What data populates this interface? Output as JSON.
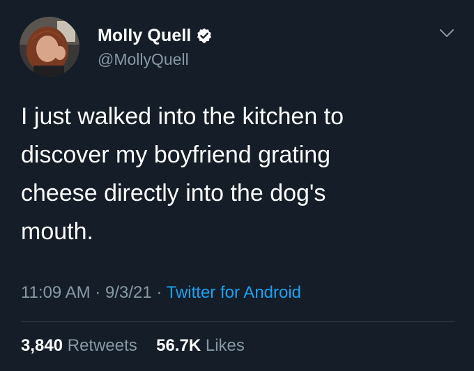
{
  "colors": {
    "background": "#141d28",
    "text_primary": "#ffffff",
    "text_secondary": "#8899a6",
    "link": "#1da1f2",
    "verified_badge": "#ffffff",
    "divider": "#38444d"
  },
  "author": {
    "display_name": "Molly Quell",
    "handle": "@MollyQuell",
    "verified": true,
    "avatar_icon": "avatar-photo"
  },
  "menu_icon": "chevron-down-icon",
  "tweet": {
    "text_lines": [
      "I just walked into the kitchen to",
      "discover my boyfriend grating",
      "cheese directly into the dog's",
      "mouth."
    ],
    "time": "11:09 AM",
    "date": "9/3/21",
    "separator": "·",
    "source": "Twitter for Android"
  },
  "stats": {
    "retweets_count": "3,840",
    "retweets_label": "Retweets",
    "likes_count": "56.7K",
    "likes_label": "Likes"
  }
}
